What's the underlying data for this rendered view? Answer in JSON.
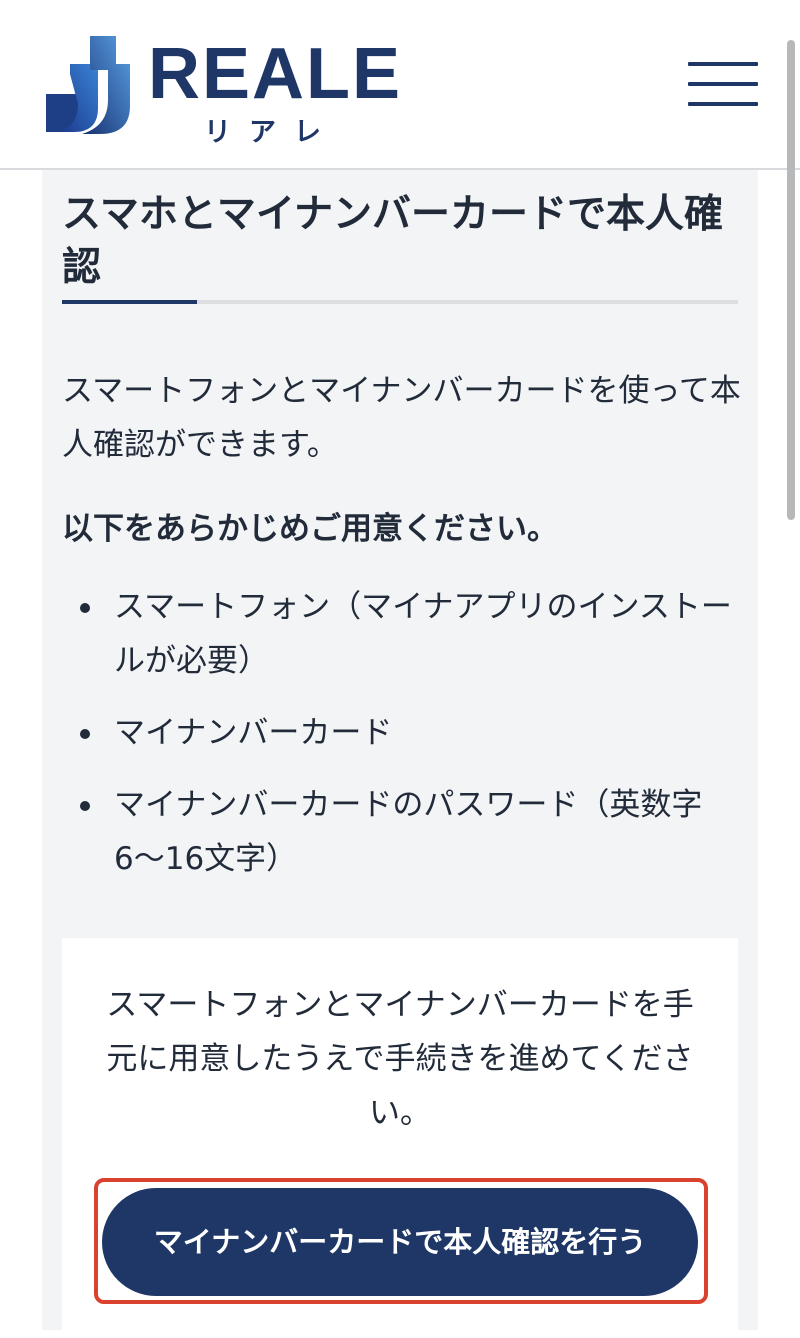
{
  "header": {
    "logo": {
      "text": "REALE",
      "subtext": "リアレ"
    },
    "menu_icon": "hamburger-menu-icon"
  },
  "main": {
    "title": "スマホとマイナンバーカードで本人確認",
    "intro": "スマートフォンとマイナンバーカードを使って本人確認ができます。",
    "prep_heading": "以下をあらかじめご用意ください。",
    "requirements": [
      "スマートフォン（マイナアプリのインストールが必要）",
      "マイナンバーカード",
      "マイナンバーカードのパスワード（英数字6〜16文字）"
    ],
    "card": {
      "text": "スマートフォンとマイナンバーカードを手元に用意したうえで手続きを進めてください。",
      "button_label": "マイナンバーカードで本人確認を行う"
    }
  },
  "colors": {
    "brand_navy": "#1f3766",
    "content_background": "#f3f4f6",
    "highlight_border": "#d9422f"
  }
}
